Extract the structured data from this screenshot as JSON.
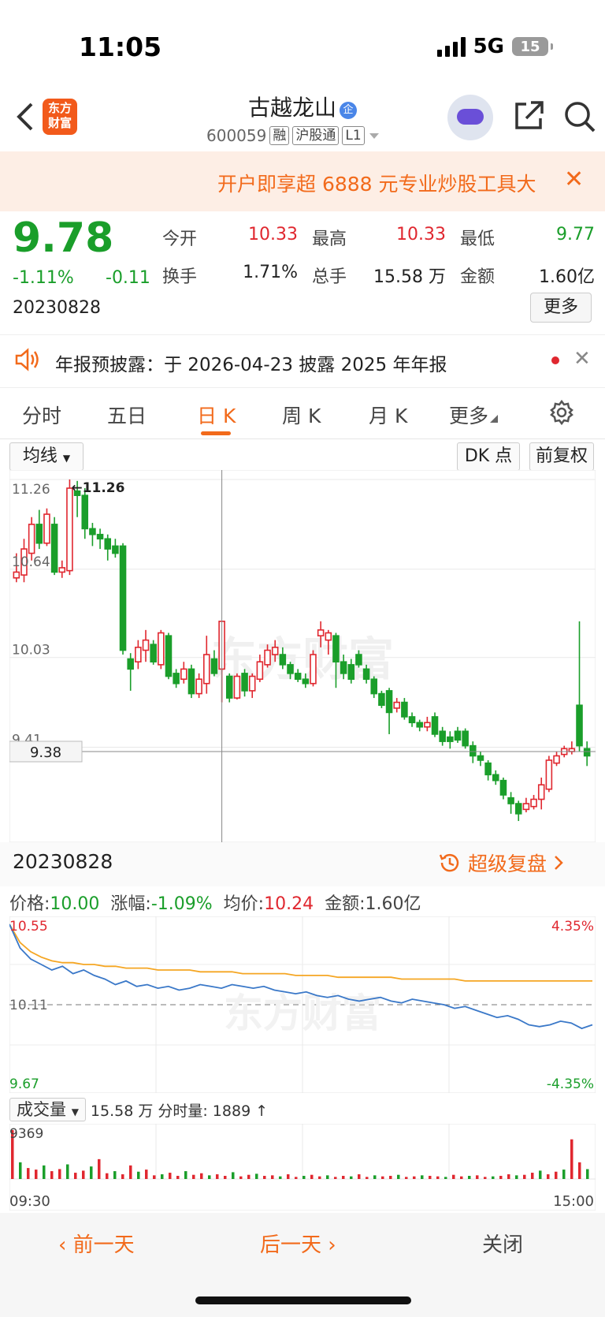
{
  "status_bar": {
    "time": "11:05",
    "network": "5G",
    "battery": "15"
  },
  "header": {
    "logo_line1": "东方",
    "logo_line2": "财富",
    "stock_name": "古越龙山",
    "name_badge": "企",
    "code": "600059",
    "tags": [
      "融",
      "沪股通",
      "L1"
    ]
  },
  "banner": {
    "text": "开户即享超 6888 元专业炒股工具大"
  },
  "quote": {
    "price": "9.78",
    "change_pct": "-1.11%",
    "change": "-0.11",
    "date": "20230828",
    "stats": [
      {
        "label": "今开",
        "value": "10.33",
        "color": "red"
      },
      {
        "label": "最高",
        "value": "10.33",
        "color": "red"
      },
      {
        "label": "最低",
        "value": "9.77",
        "color": "green"
      },
      {
        "label": "换手",
        "value": "1.71%",
        "color": "black"
      },
      {
        "label": "总手",
        "value": "15.58 万",
        "color": "black"
      },
      {
        "label": "金额",
        "value": "1.60亿",
        "color": "black"
      }
    ],
    "more_label": "更多"
  },
  "notice": {
    "text": "年报预披露：于 2026-04-23 披露 2025 年年报"
  },
  "tabs": [
    "分时",
    "五日",
    "日 K",
    "周 K",
    "月 K",
    "更多"
  ],
  "active_tab": "日 K",
  "toolbar": {
    "ma_label": "均线",
    "dk_label": "DK 点",
    "adjust_label": "前复权"
  },
  "kline": {
    "y_labels": [
      "11.26",
      "10.64",
      "10.03",
      "9.41"
    ],
    "max_marker": "11.26",
    "cursor_price": "9.38",
    "watermark": "东方财富",
    "colors": {
      "up": "#e0272f",
      "down": "#1a9e2a"
    }
  },
  "chart_data": [
    {
      "type": "candlestick",
      "title": "古越龙山 日K",
      "y_ticks": [
        11.26,
        10.64,
        10.03,
        9.41
      ],
      "ylim": [
        9.2,
        11.26
      ],
      "candles": [
        [
          10.58,
          10.62,
          10.55,
          10.75
        ],
        [
          10.6,
          10.78,
          10.55,
          10.85
        ],
        [
          10.75,
          10.95,
          10.7,
          11.0
        ],
        [
          10.95,
          10.82,
          10.78,
          11.05
        ],
        [
          10.82,
          11.02,
          10.8,
          11.06
        ],
        [
          10.95,
          10.62,
          10.6,
          11.0
        ],
        [
          10.62,
          10.65,
          10.58,
          10.7
        ],
        [
          10.63,
          11.2,
          10.6,
          11.26
        ],
        [
          11.18,
          11.15,
          11.0,
          11.25
        ],
        [
          11.15,
          10.92,
          10.85,
          11.2
        ],
        [
          10.92,
          10.88,
          10.8,
          10.96
        ],
        [
          10.88,
          10.85,
          10.78,
          10.92
        ],
        [
          10.85,
          10.78,
          10.7,
          10.88
        ],
        [
          10.8,
          10.75,
          10.72,
          10.85
        ],
        [
          10.8,
          10.08,
          10.05,
          10.82
        ],
        [
          10.02,
          9.95,
          9.8,
          10.06
        ],
        [
          10.0,
          10.1,
          9.95,
          10.15
        ],
        [
          10.08,
          10.15,
          10.0,
          10.22
        ],
        [
          10.12,
          10.0,
          9.98,
          10.15
        ],
        [
          9.98,
          10.2,
          9.95,
          10.22
        ],
        [
          10.18,
          9.9,
          9.88,
          10.2
        ],
        [
          9.92,
          9.85,
          9.82,
          9.95
        ],
        [
          9.88,
          9.95,
          9.85,
          10.0
        ],
        [
          9.95,
          9.78,
          9.75,
          9.98
        ],
        [
          9.78,
          9.88,
          9.75,
          9.92
        ],
        [
          9.85,
          10.05,
          9.78,
          10.18
        ],
        [
          10.02,
          9.92,
          9.9,
          10.08
        ],
        [
          9.95,
          10.28,
          9.72,
          10.28
        ],
        [
          9.9,
          9.75,
          9.72,
          9.92
        ],
        [
          9.75,
          9.9,
          9.74,
          9.92
        ],
        [
          9.92,
          9.8,
          9.76,
          9.95
        ],
        [
          9.8,
          9.9,
          9.75,
          9.92
        ],
        [
          9.88,
          10.0,
          9.86,
          10.05
        ],
        [
          9.98,
          10.08,
          9.96,
          10.12
        ],
        [
          10.05,
          10.1,
          10.0,
          10.15
        ],
        [
          10.05,
          9.98,
          9.95,
          10.1
        ],
        [
          9.98,
          9.92,
          9.88,
          10.0
        ],
        [
          9.92,
          9.88,
          9.86,
          9.95
        ],
        [
          9.88,
          9.85,
          9.82,
          9.92
        ],
        [
          9.85,
          10.05,
          9.83,
          10.08
        ],
        [
          10.18,
          10.22,
          10.1,
          10.28
        ],
        [
          10.15,
          10.2,
          10.05,
          10.22
        ],
        [
          10.18,
          10.0,
          9.82,
          10.2
        ],
        [
          10.0,
          9.92,
          9.88,
          10.05
        ],
        [
          9.98,
          9.88,
          9.85,
          10.02
        ],
        [
          10.05,
          9.98,
          9.96,
          10.08
        ],
        [
          9.95,
          9.88,
          9.85,
          9.98
        ],
        [
          9.88,
          9.78,
          9.75,
          9.9
        ],
        [
          9.78,
          9.7,
          9.68,
          9.8
        ],
        [
          9.8,
          9.65,
          9.5,
          9.82
        ],
        [
          9.68,
          9.72,
          9.65,
          9.75
        ],
        [
          9.72,
          9.62,
          9.6,
          9.75
        ],
        [
          9.62,
          9.58,
          9.55,
          9.65
        ],
        [
          9.58,
          9.55,
          9.52,
          9.6
        ],
        [
          9.55,
          9.58,
          9.52,
          9.62
        ],
        [
          9.62,
          9.5,
          9.48,
          9.65
        ],
        [
          9.52,
          9.45,
          9.42,
          9.55
        ],
        [
          9.48,
          9.45,
          9.4,
          9.52
        ],
        [
          9.52,
          9.46,
          9.44,
          9.55
        ],
        [
          9.52,
          9.42,
          9.4,
          9.54
        ],
        [
          9.42,
          9.35,
          9.3,
          9.45
        ],
        [
          9.35,
          9.32,
          9.28,
          9.38
        ],
        [
          9.3,
          9.22,
          9.18,
          9.32
        ],
        [
          9.22,
          9.18,
          9.15,
          9.25
        ],
        [
          9.18,
          9.08,
          9.05,
          9.2
        ],
        [
          9.06,
          9.02,
          8.95,
          9.1
        ],
        [
          9.02,
          8.95,
          8.9,
          9.04
        ],
        [
          8.98,
          9.02,
          8.96,
          9.06
        ],
        [
          9.0,
          9.05,
          8.98,
          9.08
        ],
        [
          9.05,
          9.15,
          8.98,
          9.2
        ],
        [
          9.12,
          9.32,
          9.1,
          9.35
        ],
        [
          9.3,
          9.35,
          9.28,
          9.38
        ],
        [
          9.36,
          9.4,
          9.34,
          9.42
        ],
        [
          9.38,
          9.4,
          9.36,
          9.45
        ],
        [
          9.7,
          9.42,
          9.38,
          10.28
        ],
        [
          9.4,
          9.35,
          9.28,
          9.45
        ]
      ]
    },
    {
      "type": "line",
      "title": "分时",
      "x_labels": [
        "09:30",
        "15:00"
      ],
      "left_axis": [
        "10.55",
        "10.11",
        "9.67"
      ],
      "right_axis": [
        "4.35%",
        "-4.35%"
      ],
      "ylim": [
        9.67,
        10.55
      ],
      "series": [
        {
          "name": "价格",
          "color": "#3a78c8",
          "values": [
            10.55,
            10.42,
            10.36,
            10.33,
            10.3,
            10.32,
            10.28,
            10.3,
            10.27,
            10.25,
            10.22,
            10.24,
            10.21,
            10.22,
            10.2,
            10.21,
            10.19,
            10.2,
            10.22,
            10.21,
            10.2,
            10.22,
            10.21,
            10.2,
            10.21,
            10.19,
            10.18,
            10.17,
            10.18,
            10.16,
            10.15,
            10.16,
            10.14,
            10.13,
            10.14,
            10.15,
            10.13,
            10.12,
            10.14,
            10.13,
            10.12,
            10.11,
            10.09,
            10.1,
            10.08,
            10.06,
            10.04,
            10.05,
            10.03,
            10.0,
            9.99,
            10.0,
            10.02,
            10.01,
            9.98,
            10.0
          ]
        },
        {
          "name": "均价",
          "color": "#f5a623",
          "values": [
            10.55,
            10.45,
            10.4,
            10.37,
            10.35,
            10.34,
            10.34,
            10.33,
            10.33,
            10.32,
            10.32,
            10.31,
            10.31,
            10.31,
            10.3,
            10.3,
            10.3,
            10.3,
            10.29,
            10.29,
            10.29,
            10.29,
            10.28,
            10.28,
            10.28,
            10.28,
            10.28,
            10.27,
            10.27,
            10.27,
            10.27,
            10.26,
            10.26,
            10.26,
            10.26,
            10.26,
            10.26,
            10.25,
            10.25,
            10.25,
            10.25,
            10.25,
            10.25,
            10.24,
            10.24,
            10.24,
            10.24,
            10.24,
            10.24,
            10.24,
            10.24,
            10.24,
            10.24,
            10.24,
            10.24,
            10.24
          ]
        }
      ]
    },
    {
      "type": "bar",
      "title": "成交量",
      "y_max_label": "9369",
      "x_labels": [
        "09:30",
        "15:00"
      ],
      "values": [
        9369,
        3200,
        2100,
        1800,
        2600,
        1500,
        1900,
        2800,
        1200,
        1600,
        2400,
        3800,
        1100,
        1500,
        900,
        2600,
        1400,
        1800,
        700,
        900,
        1200,
        600,
        1500,
        800,
        1100,
        700,
        900,
        600,
        1300,
        500,
        800,
        1000,
        600,
        700,
        500,
        900,
        400,
        600,
        800,
        500,
        700,
        400,
        600,
        500,
        900,
        400,
        700,
        500,
        600,
        800,
        400,
        500,
        700,
        600,
        500,
        400,
        800,
        500,
        600,
        700,
        400,
        500,
        600,
        900,
        700,
        800,
        1200,
        1600,
        900,
        1400,
        1800,
        7600,
        3200,
        1889
      ]
    }
  ],
  "info_row": {
    "price_label": "价格:",
    "price": "10.00",
    "chg_label": "涨幅:",
    "chg": "-1.09%",
    "avg_label": "均价:",
    "avg": "10.24",
    "amt_label": "金额:",
    "amt": "1.60亿"
  },
  "intraday_date": "20230828",
  "replay_label": "超级复盘",
  "volume": {
    "selector_label": "成交量",
    "total": "15.58 万",
    "tick_label": "分时量: 1889 ↑"
  },
  "footer": {
    "prev": "前一天",
    "next": "后一天",
    "close": "关闭"
  }
}
